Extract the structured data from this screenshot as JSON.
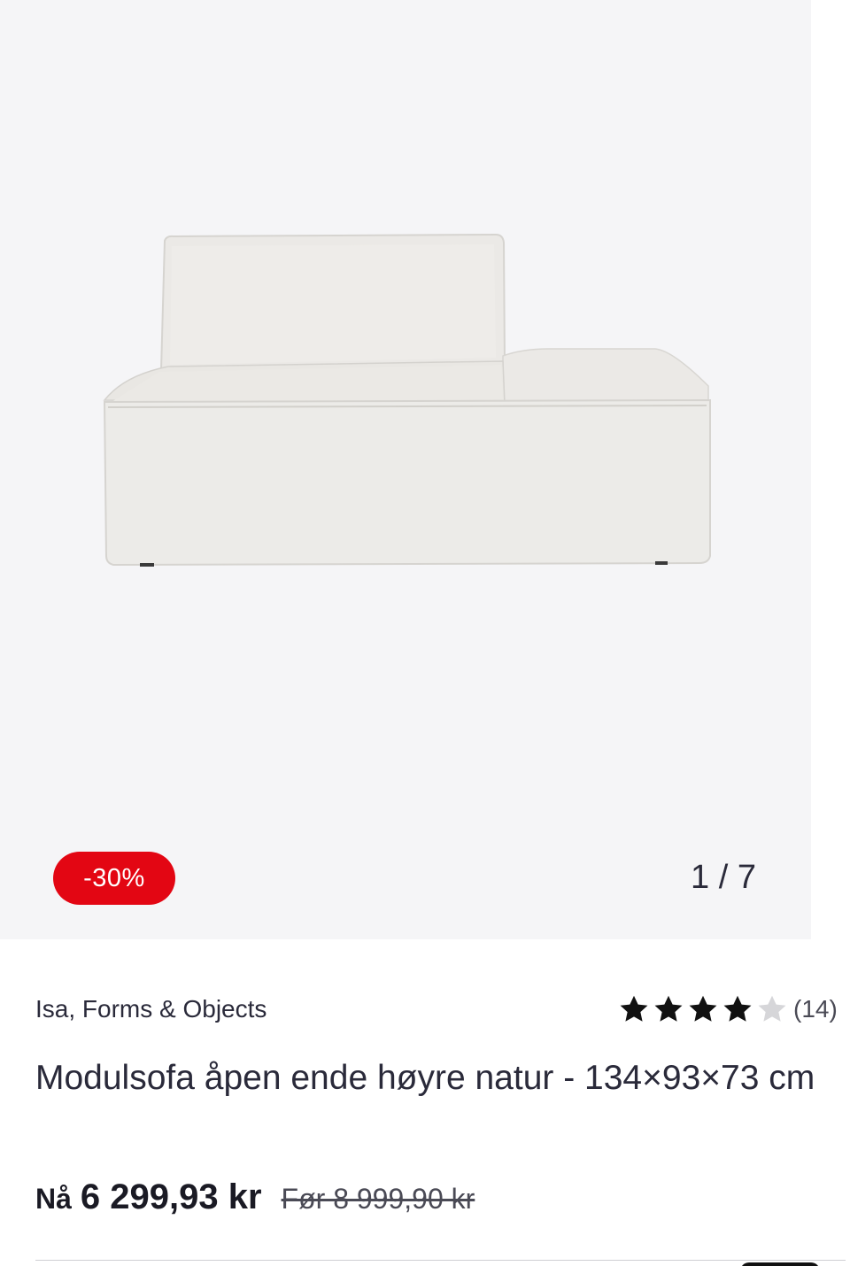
{
  "gallery": {
    "discount_badge": "-30%",
    "slide_counter": "1 / 7",
    "image_icon": "sofa-module-image"
  },
  "product": {
    "brand": "Isa, Forms & Objects",
    "title": "Modulsofa åpen ende høyre natur - 134×93×73 cm",
    "rating": {
      "value": 4,
      "max": 5,
      "count_text": "(14)"
    },
    "price": {
      "now_label": "Nå",
      "now": "6 299,93 kr",
      "before": "Før 8 999,90 kr"
    }
  },
  "colors": {
    "badge": "#e30613",
    "gallery_bg": "#f5f5f7",
    "text": "#2a2a3a"
  }
}
